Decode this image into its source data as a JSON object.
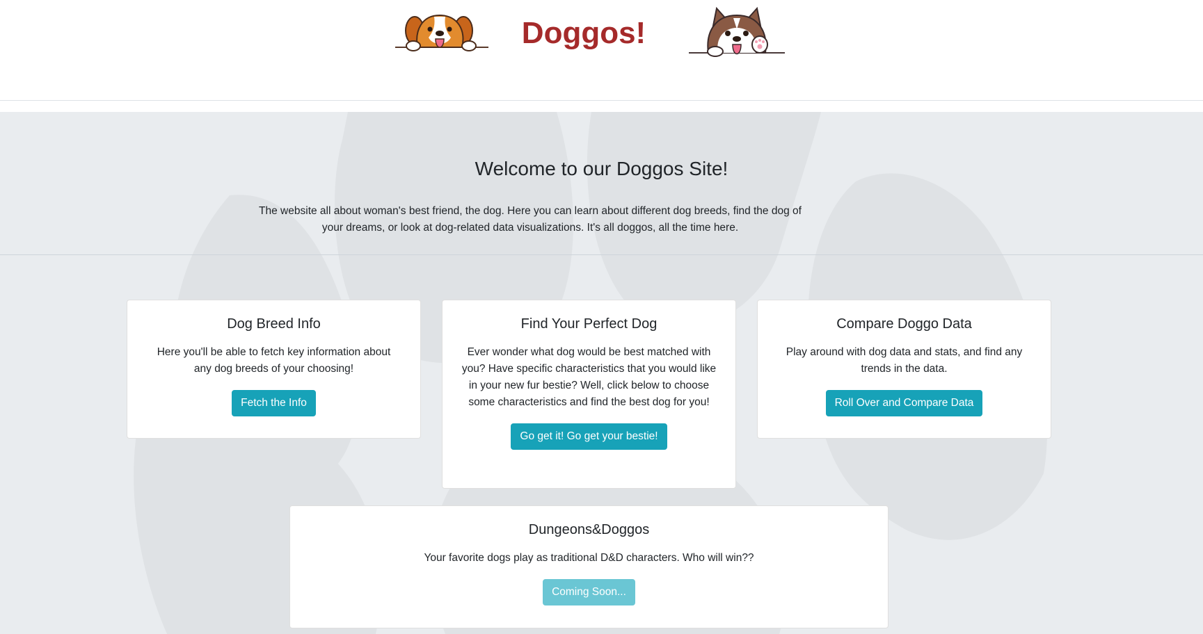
{
  "header": {
    "title": "Doggos!",
    "left_logo_icon": "beagle-peeking-icon",
    "right_logo_icon": "husky-waving-icon"
  },
  "hero": {
    "title": "Welcome to our Doggos Site!",
    "text": "The website all about woman's best friend, the dog. Here you can learn about different dog breeds, find the dog of your dreams, or look at dog-related data visualizations. It's all doggos, all the time here."
  },
  "cards": [
    {
      "title": "Dog Breed Info",
      "text": "Here you'll be able to fetch key information about any dog breeds of your choosing!",
      "button": "Fetch the Info"
    },
    {
      "title": "Find Your Perfect Dog",
      "text": "Ever wonder what dog would be best matched with you? Have specific characteristics that you would like in your new fur bestie? Well, click below to choose some characteristics and find the best dog for you!",
      "button": "Go get it! Go get your bestie!"
    },
    {
      "title": "Compare Doggo Data",
      "text": "Play around with dog data and stats, and find any trends in the data.",
      "button": "Roll Over and Compare Data"
    },
    {
      "title": "Dungeons&Doggos",
      "text": "Your favorite dogs play as traditional D&D characters. Who will win??",
      "button": "Coming Soon..."
    }
  ],
  "colors": {
    "title_red": "#a52a2a",
    "button_teal": "#17a2b8",
    "button_disabled": "#6ac6d4",
    "page_background": "#e9ecef"
  }
}
